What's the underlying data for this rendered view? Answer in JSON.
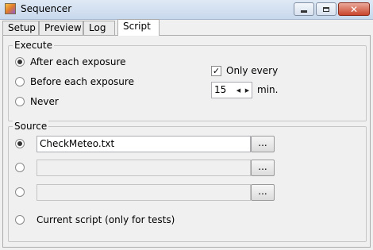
{
  "window": {
    "title": "Sequencer"
  },
  "tabs": [
    {
      "label": "Setup"
    },
    {
      "label": "Preview"
    },
    {
      "label": "Log"
    },
    {
      "label": "Script",
      "active": true
    }
  ],
  "execute": {
    "legend": "Execute",
    "options": [
      {
        "label": "After each exposure",
        "selected": true
      },
      {
        "label": "Before each exposure",
        "selected": false
      },
      {
        "label": "Never",
        "selected": false
      }
    ],
    "only_every": {
      "label": "Only every",
      "checked": true,
      "value": "15",
      "unit": "min."
    }
  },
  "source": {
    "legend": "Source",
    "rows": [
      {
        "value": "CheckMeteo.txt",
        "selected": true,
        "browse": "..."
      },
      {
        "value": "",
        "selected": false,
        "browse": "..."
      },
      {
        "value": "",
        "selected": false,
        "browse": "..."
      }
    ],
    "current_script_label": "Current script (only for tests)"
  }
}
